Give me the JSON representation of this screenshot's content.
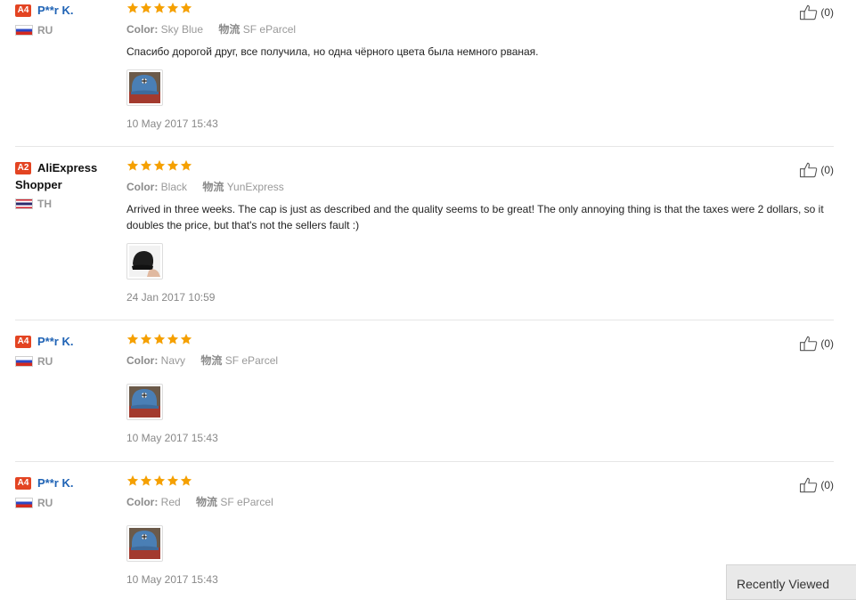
{
  "reviews": [
    {
      "level": "A4",
      "name": "P**r K.",
      "name_style": "link",
      "country": "RU",
      "rating": 5,
      "color_label": "Color:",
      "color_value": "Sky Blue",
      "logistics_label": "物流",
      "logistics_value": "SF eParcel",
      "text": "Спасибо дорогой друг, все получила, но одна чёрного цвета была немного рваная.",
      "image": "blue cap with white flower",
      "date": "10 May 2017 15:43",
      "helpful_count": "(0)"
    },
    {
      "level": "A2",
      "name": "AliExpress Shopper",
      "name_style": "plain",
      "country": "TH",
      "rating": 5,
      "color_label": "Color:",
      "color_value": "Black",
      "logistics_label": "物流",
      "logistics_value": "YunExpress",
      "text": "Arrived in three weeks. The cap is just as described and the quality seems to be great! The only annoying thing is that the taxes were 2 dollars, so it doubles the price, but that's not the sellers fault :)",
      "image": "black cap held in hand",
      "date": "24 Jan 2017 10:59",
      "helpful_count": "(0)"
    },
    {
      "level": "A4",
      "name": "P**r K.",
      "name_style": "link",
      "country": "RU",
      "rating": 5,
      "color_label": "Color:",
      "color_value": "Navy",
      "logistics_label": "物流",
      "logistics_value": "SF eParcel",
      "text": "",
      "image": "blue cap with white flower",
      "date": "10 May 2017 15:43",
      "helpful_count": "(0)"
    },
    {
      "level": "A4",
      "name": "P**r K.",
      "name_style": "link",
      "country": "RU",
      "rating": 5,
      "color_label": "Color:",
      "color_value": "Red",
      "logistics_label": "物流",
      "logistics_value": "SF eParcel",
      "text": "",
      "image": "blue cap with white flower",
      "date": "10 May 2017 15:43",
      "helpful_count": "(0)"
    }
  ],
  "recently_viewed": {
    "label": "Recently Viewed"
  },
  "colors": {
    "star": "#f5a000",
    "badge": "#e34422",
    "link": "#1f63b5"
  }
}
